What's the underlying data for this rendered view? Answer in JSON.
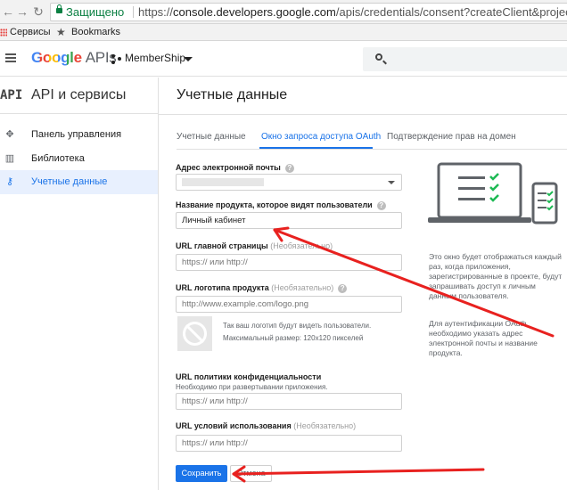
{
  "browser": {
    "secure_label": "Защищено",
    "url_prefix": "https://",
    "url_host": "console.developers.google.com",
    "url_path": "/apis/credentials/consent?createClient&project=membership-",
    "bookmarks": [
      "Сервисы",
      "Bookmarks"
    ]
  },
  "header": {
    "logo_google": "Google",
    "logo_apis": "APIs",
    "project_name": "MemberShip"
  },
  "sidebar": {
    "logo": "API",
    "title": "API и сервисы",
    "items": [
      {
        "label": "Панель управления",
        "icon": "dashboard-icon"
      },
      {
        "label": "Библиотека",
        "icon": "library-icon"
      },
      {
        "label": "Учетные данные",
        "icon": "key-icon",
        "active": true
      }
    ]
  },
  "main": {
    "title": "Учетные данные",
    "tabs": [
      {
        "label": "Учетные данные"
      },
      {
        "label": "Окно запроса доступа OAuth",
        "active": true
      },
      {
        "label": "Подтверждение прав на домен"
      }
    ],
    "form": {
      "email_label": "Адрес электронной почты",
      "product_name_label": "Название продукта, которое видят пользователи",
      "product_name_value": "Личный кабинет",
      "homepage_label": "URL главной страницы",
      "optional_label": "(Необязательно)",
      "homepage_placeholder": "https:// или http://",
      "logo_url_label": "URL логотипа продукта",
      "logo_url_placeholder": "http://www.example.com/logo.png",
      "logo_note_line1": "Так ваш логотип будут видеть пользователи.",
      "logo_note_line2": "Максимальный размер: 120x120 пикселей",
      "privacy_label": "URL политики конфиденциальности",
      "privacy_hint": "Необходимо при развертывании приложения.",
      "privacy_placeholder": "https:// или http://",
      "tos_label": "URL условий использования",
      "tos_placeholder": "https:// или http://",
      "save_label": "Сохранить",
      "cancel_label": "Отмена"
    },
    "info_1": "Это окно будет отображаться каждый раз, когда приложения, зарегистрированные в проекте, будут запрашивать доступ к личным данным пользователя.",
    "info_2": "Для аутентификации OAuth необходимо указать адрес электронной почты и название продукта."
  },
  "colors": {
    "accent": "#1a73e8",
    "annotation_arrow": "#e8211f",
    "secure_green": "#0b8043"
  }
}
